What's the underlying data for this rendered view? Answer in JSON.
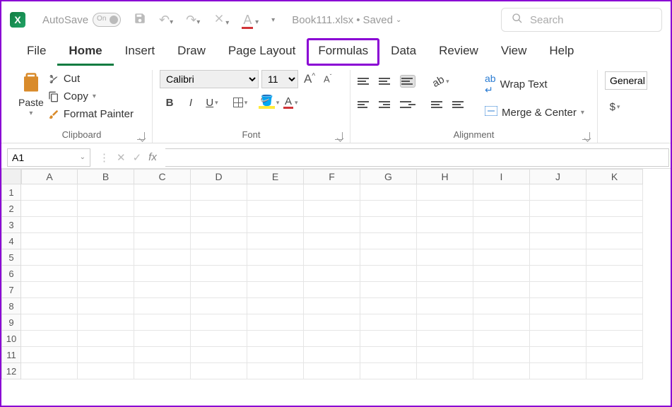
{
  "titlebar": {
    "autosave_label": "AutoSave",
    "autosave_state": "On",
    "doc_name": "Book111.xlsx",
    "doc_status": "Saved",
    "search_placeholder": "Search"
  },
  "tabs": [
    "File",
    "Home",
    "Insert",
    "Draw",
    "Page Layout",
    "Formulas",
    "Data",
    "Review",
    "View",
    "Help"
  ],
  "active_tab": "Home",
  "highlighted_tab": "Formulas",
  "ribbon": {
    "clipboard": {
      "paste": "Paste",
      "cut": "Cut",
      "copy": "Copy",
      "format_painter": "Format Painter",
      "group_label": "Clipboard"
    },
    "font": {
      "name": "Calibri",
      "size": "11",
      "group_label": "Font"
    },
    "alignment": {
      "wrap": "Wrap Text",
      "merge": "Merge & Center",
      "group_label": "Alignment"
    },
    "number": {
      "format": "General",
      "currency": "$"
    }
  },
  "formula_bar": {
    "name_box": "A1",
    "formula": ""
  },
  "grid": {
    "columns": [
      "A",
      "B",
      "C",
      "D",
      "E",
      "F",
      "G",
      "H",
      "I",
      "J",
      "K"
    ],
    "rows": [
      1,
      2,
      3,
      4,
      5,
      6,
      7,
      8,
      9,
      10,
      11,
      12
    ]
  }
}
